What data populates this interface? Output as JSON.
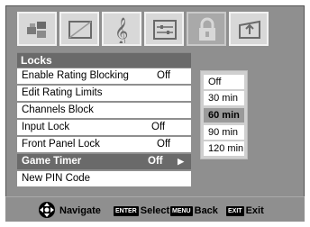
{
  "menu_icons": [
    "picture-icon",
    "sound-icon",
    "music-icon",
    "settings-icon",
    "lock-icon",
    "setup-icon"
  ],
  "panel": {
    "title": "Locks",
    "items": [
      {
        "label": "Enable Rating Blocking",
        "value": "Off"
      },
      {
        "label": "Edit Rating Limits",
        "value": ""
      },
      {
        "label": "Channels Block",
        "value": ""
      },
      {
        "label": "Input Lock",
        "value": "Off"
      },
      {
        "label": "Front Panel Lock",
        "value": "Off"
      },
      {
        "label": "Game Timer",
        "value": "Off"
      },
      {
        "label": "New PIN Code",
        "value": ""
      }
    ]
  },
  "submenu": {
    "options": [
      "Off",
      "30 min",
      "60 min",
      "90 min",
      "120 min"
    ],
    "selected": "60 min"
  },
  "bottom_bar": {
    "navigate_label": "Navigate",
    "enter_key": "ENTER",
    "select_label": "Select",
    "menu_key": "MENU",
    "back_label": "Back",
    "exit_key": "EXIT",
    "exit_label": "Exit"
  }
}
